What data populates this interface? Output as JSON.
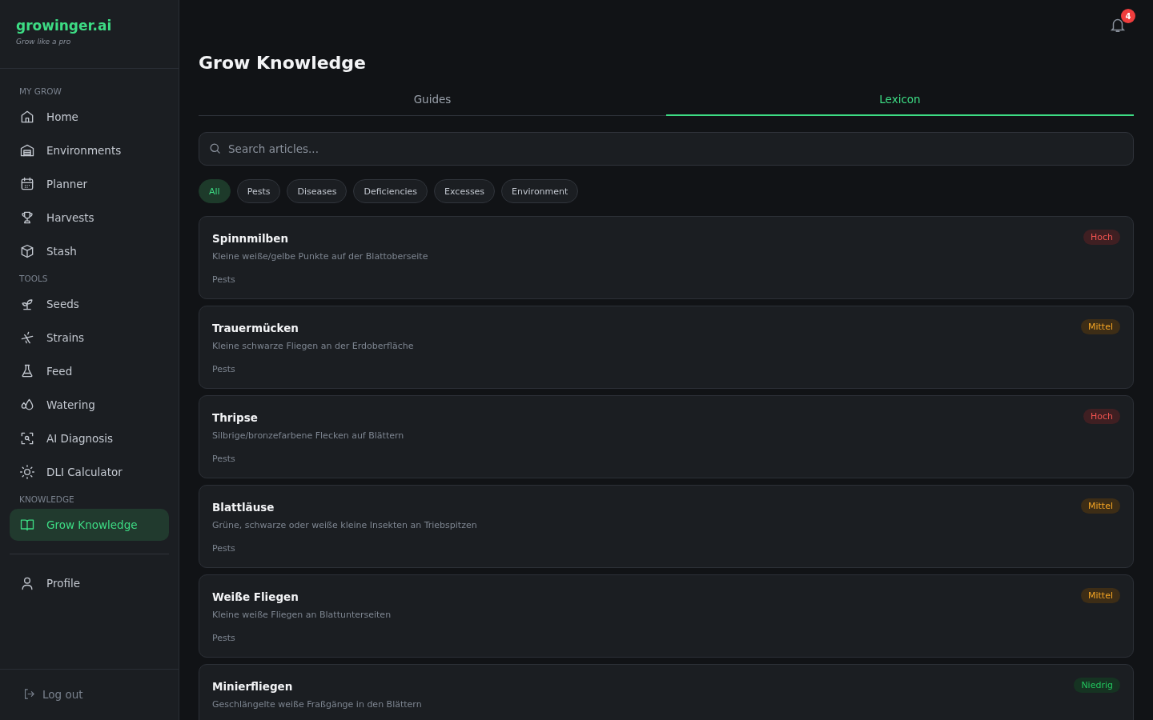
{
  "sidebar": {
    "logo": "growinger.ai",
    "tagline": "Grow like a pro",
    "sections": [
      {
        "heading": "MY GROW",
        "items": [
          {
            "label": "Home",
            "selected": false
          },
          {
            "label": "Environments",
            "selected": false
          },
          {
            "label": "Planner",
            "selected": false
          },
          {
            "label": "Harvests",
            "selected": false
          },
          {
            "label": "Stash",
            "selected": false
          }
        ]
      },
      {
        "heading": "TOOLS",
        "items": [
          {
            "label": "Seeds",
            "selected": false
          },
          {
            "label": "Strains",
            "selected": false
          },
          {
            "label": "Feed",
            "selected": false
          },
          {
            "label": "Watering",
            "selected": false
          },
          {
            "label": "AI Diagnosis",
            "selected": false
          },
          {
            "label": "DLI Calculator",
            "selected": false
          }
        ]
      },
      {
        "heading": "KNOWLEDGE",
        "items": [
          {
            "label": "Grow Knowledge",
            "selected": true
          }
        ]
      }
    ],
    "profile": {
      "label": "Profile",
      "selected": false
    },
    "logout": "Log out"
  },
  "notifications": {
    "count": "4"
  },
  "page_title": "Grow Knowledge",
  "tabs": [
    {
      "label": "Guides",
      "selected": false
    },
    {
      "label": "Lexicon",
      "selected": true
    }
  ],
  "search": {
    "placeholder": "Search articles..."
  },
  "filters": [
    {
      "label": "All",
      "selected": true
    },
    {
      "label": "Pests",
      "selected": false
    },
    {
      "label": "Diseases",
      "selected": false
    },
    {
      "label": "Deficiencies",
      "selected": false
    },
    {
      "label": "Excesses",
      "selected": false
    },
    {
      "label": "Environment",
      "selected": false
    }
  ],
  "articles": [
    {
      "title": "Spinnmilben",
      "description": "Kleine weiße/gelbe Punkte auf der Blattoberseite",
      "category": "Pests",
      "severity": "Hoch",
      "kind": "high"
    },
    {
      "title": "Trauermücken",
      "description": "Kleine schwarze Fliegen an der Erdoberfläche",
      "category": "Pests",
      "severity": "Mittel",
      "kind": "medium"
    },
    {
      "title": "Thripse",
      "description": "Silbrige/bronzefarbene Flecken auf Blättern",
      "category": "Pests",
      "severity": "Hoch",
      "kind": "high"
    },
    {
      "title": "Blattläuse",
      "description": "Grüne, schwarze oder weiße kleine Insekten an Triebspitzen",
      "category": "Pests",
      "severity": "Mittel",
      "kind": "medium"
    },
    {
      "title": "Weiße Fliegen",
      "description": "Kleine weiße Fliegen an Blattunterseiten",
      "category": "Pests",
      "severity": "Mittel",
      "kind": "medium"
    },
    {
      "title": "Minierfliegen",
      "description": "Geschlängelte weiße Fraßgänge in den Blättern",
      "severity": "Niedrig",
      "kind": "low"
    }
  ]
}
